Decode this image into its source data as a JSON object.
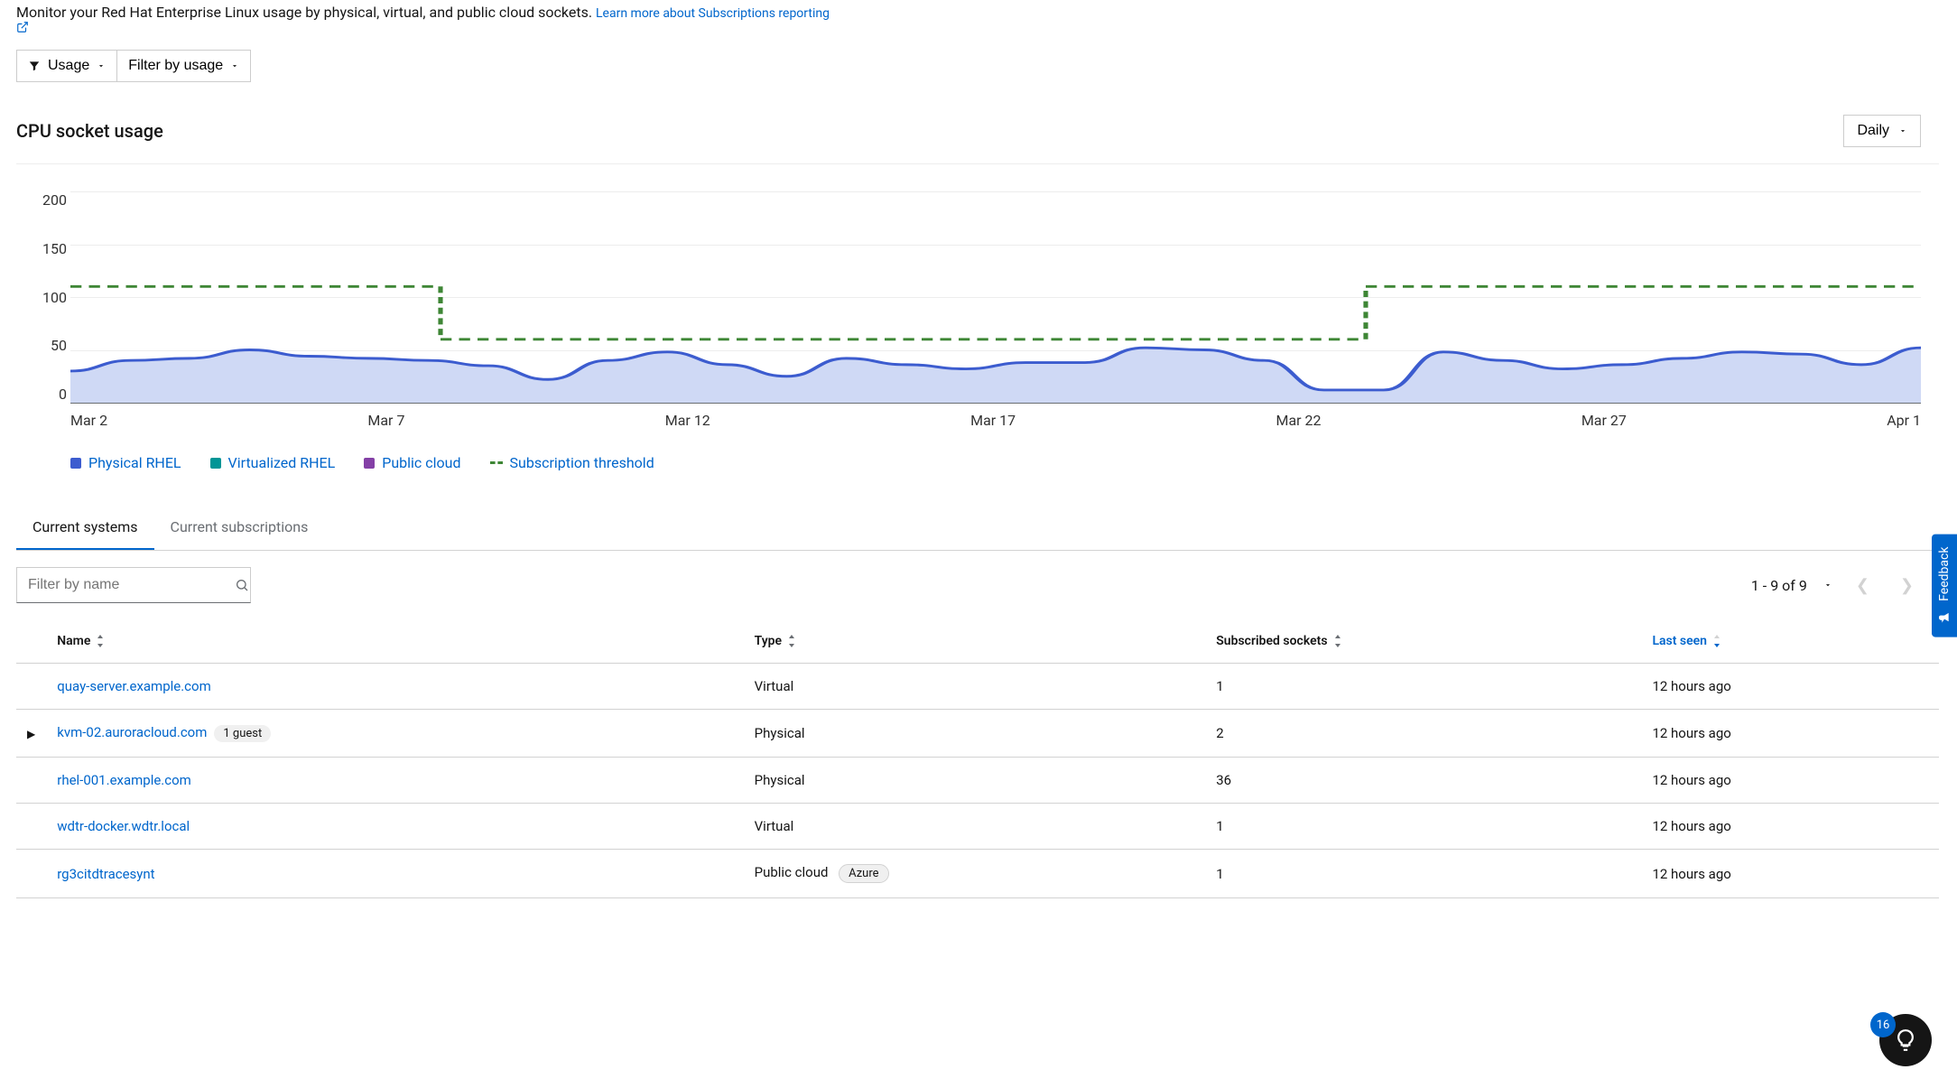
{
  "intro": {
    "text": "Monitor your Red Hat Enterprise Linux usage by physical, virtual, and public cloud sockets. ",
    "link_text": "Learn more about Subscriptions reporting"
  },
  "filters": {
    "primary_label": "Usage",
    "secondary_label": "Filter by usage"
  },
  "section": {
    "title": "CPU socket usage",
    "granularity": "Daily"
  },
  "chart_data": {
    "type": "area",
    "title": "CPU socket usage",
    "ylabel": "",
    "xlabel": "",
    "ylim": [
      0,
      200
    ],
    "y_ticks": [
      200,
      150,
      100,
      50,
      0
    ],
    "x_ticks": [
      "Mar 2",
      "Mar 7",
      "Mar 12",
      "Mar 17",
      "Mar 22",
      "Mar 27",
      "Apr 1"
    ],
    "categories": [
      "Mar 2",
      "Mar 3",
      "Mar 4",
      "Mar 5",
      "Mar 6",
      "Mar 7",
      "Mar 8",
      "Mar 9",
      "Mar 10",
      "Mar 11",
      "Mar 12",
      "Mar 13",
      "Mar 14",
      "Mar 15",
      "Mar 16",
      "Mar 17",
      "Mar 18",
      "Mar 19",
      "Mar 20",
      "Mar 21",
      "Mar 22",
      "Mar 23",
      "Mar 24",
      "Mar 25",
      "Mar 26",
      "Mar 27",
      "Mar 28",
      "Mar 29",
      "Mar 30",
      "Mar 31",
      "Apr 1"
    ],
    "series": [
      {
        "name": "Physical RHEL",
        "color": "#3c5ccf",
        "values": [
          30,
          40,
          42,
          50,
          44,
          42,
          40,
          35,
          22,
          40,
          48,
          36,
          25,
          42,
          36,
          32,
          38,
          38,
          52,
          50,
          40,
          12,
          12,
          48,
          40,
          32,
          36,
          42,
          48,
          46,
          36,
          52
        ]
      },
      {
        "name": "Virtualized RHEL",
        "color": "#009596",
        "values": []
      },
      {
        "name": "Public cloud",
        "color": "#8440a6",
        "values": []
      },
      {
        "name": "Subscription threshold",
        "color": "#3e8635",
        "style": "dashed",
        "values": [
          110,
          110,
          110,
          110,
          110,
          110,
          60,
          60,
          60,
          60,
          60,
          60,
          60,
          60,
          60,
          60,
          60,
          60,
          60,
          60,
          60,
          110,
          110,
          110,
          110,
          110,
          110,
          110,
          110,
          110,
          110
        ]
      }
    ],
    "legend": [
      "Physical RHEL",
      "Virtualized RHEL",
      "Public cloud",
      "Subscription threshold"
    ]
  },
  "tabs": {
    "items": [
      "Current systems",
      "Current subscriptions"
    ],
    "active_index": 0
  },
  "table": {
    "filter_placeholder": "Filter by name",
    "pagination_text": "1 - 9 of 9",
    "columns": [
      "Name",
      "Type",
      "Subscribed sockets",
      "Last seen"
    ],
    "sort_active_index": 3,
    "rows": [
      {
        "name": "quay-server.example.com",
        "expandable": false,
        "badge": "",
        "type": "Virtual",
        "type_badge": "",
        "sockets": "1",
        "last_seen": "12 hours ago"
      },
      {
        "name": "kvm-02.auroracloud.com",
        "expandable": true,
        "badge": "1 guest",
        "type": "Physical",
        "type_badge": "",
        "sockets": "2",
        "last_seen": "12 hours ago"
      },
      {
        "name": "rhel-001.example.com",
        "expandable": false,
        "badge": "",
        "type": "Physical",
        "type_badge": "",
        "sockets": "36",
        "last_seen": "12 hours ago"
      },
      {
        "name": "wdtr-docker.wdtr.local",
        "expandable": false,
        "badge": "",
        "type": "Virtual",
        "type_badge": "",
        "sockets": "1",
        "last_seen": "12 hours ago"
      },
      {
        "name": "rg3citdtracesynt",
        "expandable": false,
        "badge": "",
        "type": "Public cloud",
        "type_badge": "Azure",
        "sockets": "1",
        "last_seen": "12 hours ago"
      }
    ]
  },
  "feedback": {
    "label": "Feedback"
  },
  "help": {
    "badge_count": "16"
  }
}
